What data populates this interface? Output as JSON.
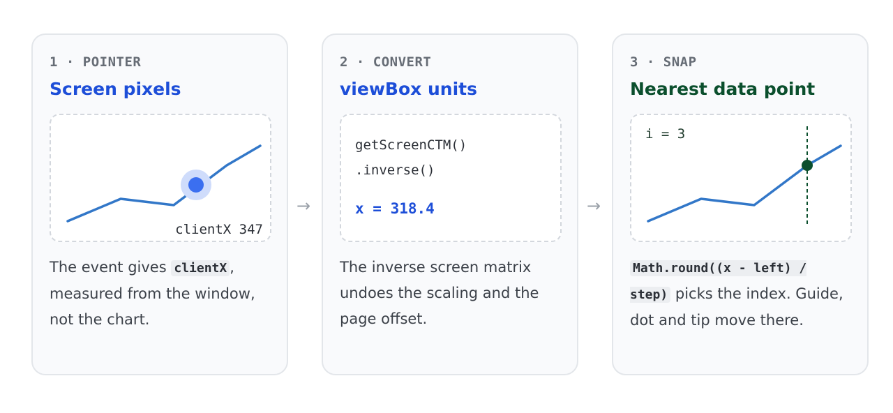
{
  "steps": [
    {
      "label": "1 · POINTER",
      "title": "Screen pixels",
      "readout": "clientX 347",
      "desc_before": "The event gives ",
      "desc_code": "clientX",
      "desc_after": ", measured from the window, not the chart."
    },
    {
      "label": "2 · CONVERT",
      "title": "viewBox units",
      "code_lines": [
        "getScreenCTM()",
        ".inverse()"
      ],
      "result": "x = 318.4",
      "desc": "The inverse screen matrix undoes the scaling and the page offset."
    },
    {
      "label": "3 · SNAP",
      "title": "Nearest data point",
      "readout": "i = 3",
      "desc_code": "Math.round((x - left) / step)",
      "desc_after": " picks the index. Guide, dot and tip move there."
    }
  ],
  "arrow_glyph": "→",
  "colors": {
    "line": "#3277c8",
    "pointer": "#3b6ff0",
    "pointer_halo": "#cfdcfb",
    "snap_dot": "#0b4f2d",
    "title_blue": "#1d4ed8",
    "title_green": "#0b4f2d"
  },
  "icons": {
    "pointer": "pointer-dot-icon",
    "arrow": "right-arrow-icon"
  }
}
